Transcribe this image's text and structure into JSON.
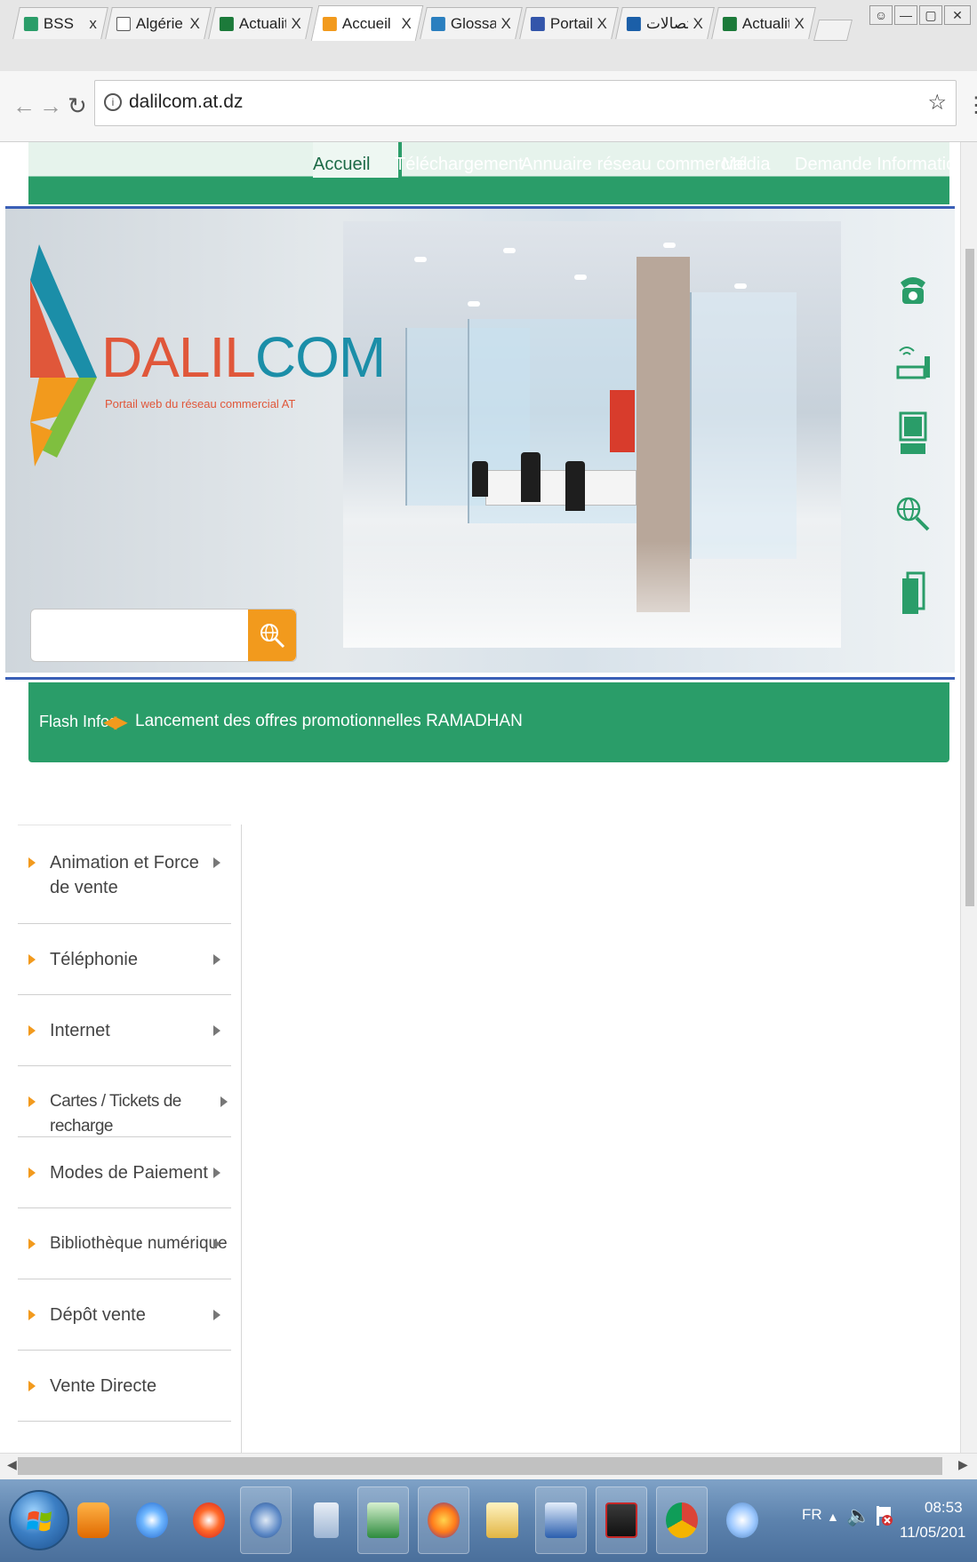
{
  "browser": {
    "tabs": [
      {
        "title": "BSS",
        "close": "x",
        "favicon_color": "#2a9d69",
        "active": false
      },
      {
        "title": "Algérie",
        "close": "X",
        "favicon_color": "#ffffff",
        "active": false
      },
      {
        "title": "Actualit",
        "close": "X",
        "favicon_color": "#1c7a3a",
        "active": false
      },
      {
        "title": "Accueil",
        "close": "X",
        "favicon_color": "#f29a1d",
        "active": true
      },
      {
        "title": "Glossai",
        "close": "X",
        "favicon_color": "#2a7fbf",
        "active": false
      },
      {
        "title": "Portail",
        "close": "X",
        "favicon_color": "#3355aa",
        "active": false
      },
      {
        "title": "إتصالات",
        "close": "X",
        "favicon_color": "#1b5fa8",
        "active": false
      },
      {
        "title": "Actualit",
        "close": "X",
        "favicon_color": "#1c7a3a",
        "active": false
      }
    ],
    "url": "dalilcom.at.dz",
    "window_controls": [
      "user",
      "minimize",
      "maximize",
      "close"
    ]
  },
  "nav": {
    "items": [
      "Accueil",
      "Téléchargement",
      "Annuaire réseau commercial",
      "Média",
      "Demande Information"
    ],
    "active": "Accueil"
  },
  "logo": {
    "name_part1": "DALIL",
    "name_part2": "COM",
    "tagline": "Portail web du réseau commercial AT"
  },
  "search": {
    "placeholder": "",
    "button_icon": "globe-search-icon"
  },
  "side_icons": [
    "telephone-icon",
    "modem-icon",
    "computer-icon",
    "globe-search-icon",
    "documents-icon"
  ],
  "flash": {
    "label": "Flash Infos",
    "text": "Lancement des offres promotionnelles RAMADHAN"
  },
  "sidebar": {
    "items": [
      {
        "label": "Animation et Force de vente",
        "has_submenu": true
      },
      {
        "label": "Téléphonie",
        "has_submenu": true
      },
      {
        "label": "Internet",
        "has_submenu": true
      },
      {
        "label": "Cartes / Tickets de recharge",
        "has_submenu": true
      },
      {
        "label": "Modes de Paiement",
        "has_submenu": true
      },
      {
        "label": "Bibliothèque numérique",
        "has_submenu": true
      },
      {
        "label": "Dépôt vente",
        "has_submenu": true
      },
      {
        "label": "Vente Directe",
        "has_submenu": false
      }
    ]
  },
  "taskbar": {
    "apps": [
      "media-player-icon",
      "internet-explorer-icon",
      "opera-icon",
      "thunderbird-icon",
      "calculator-icon",
      "excel-icon",
      "firefox-icon",
      "file-explorer-icon",
      "word-icon",
      "acrobat-icon",
      "chrome-icon",
      "paint-icon"
    ],
    "language": "FR",
    "time": "08:53",
    "date": "11/05/201"
  },
  "colors": {
    "brand_green": "#2a9d69",
    "accent_orange": "#f29a1d",
    "logo_red": "#e0573a",
    "logo_blue": "#1b8ea8",
    "rule_blue": "#3a5fb6"
  }
}
